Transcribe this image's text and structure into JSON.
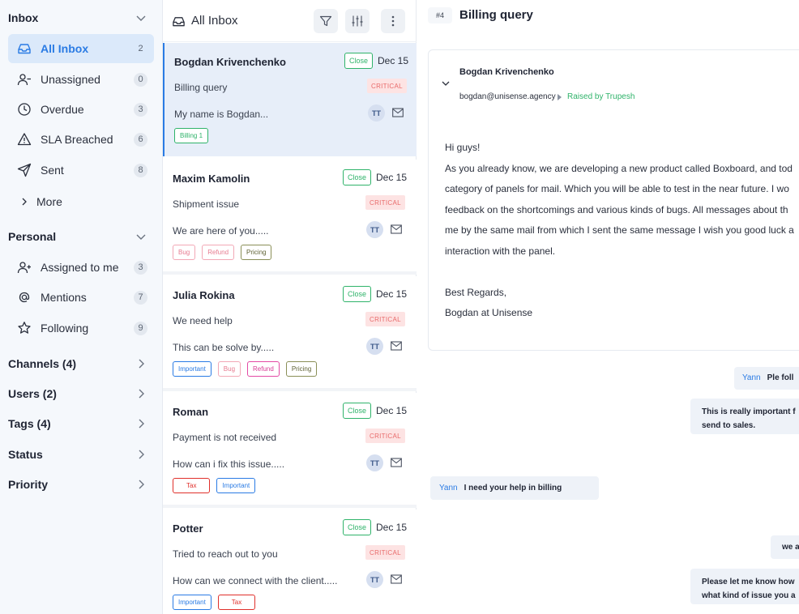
{
  "sidebar": {
    "inbox_section": "Inbox",
    "inbox_items": [
      {
        "label": "All Inbox",
        "count": "2",
        "icon": "inbox-icon",
        "active": true
      },
      {
        "label": "Unassigned",
        "count": "0",
        "icon": "user-minus-icon"
      },
      {
        "label": "Overdue",
        "count": "3",
        "icon": "clock-icon"
      },
      {
        "label": "SLA Breached",
        "count": "6",
        "icon": "warning-icon"
      },
      {
        "label": "Sent",
        "count": "8",
        "icon": "send-icon"
      }
    ],
    "more_label": "More",
    "personal_section": "Personal",
    "personal_items": [
      {
        "label": "Assigned to me",
        "count": "3",
        "icon": "user-plus-icon"
      },
      {
        "label": "Mentions",
        "count": "7",
        "icon": "at-icon"
      },
      {
        "label": "Following",
        "count": "9",
        "icon": "star-icon"
      }
    ],
    "groups": [
      {
        "label": "Channels (4)"
      },
      {
        "label": "Users (2)"
      },
      {
        "label": "Tags (4)"
      },
      {
        "label": "Status"
      },
      {
        "label": "Priority"
      }
    ]
  },
  "list": {
    "title": "All Inbox",
    "tickets": [
      {
        "name": "Bogdan Krivenchenko",
        "status": "Close",
        "date": "Dec 15",
        "subject": "Billing query",
        "priority": "CRITICAL",
        "preview": "My name is Bogdan...",
        "avatar": "TT",
        "tags": [
          {
            "label": "Billing 1",
            "color": "green"
          }
        ]
      },
      {
        "name": "Maxim Kamolin",
        "status": "Close",
        "date": "Dec 15",
        "subject": "Shipment issue",
        "priority": "CRITICAL",
        "preview": "We are here of you.....",
        "avatar": "TT",
        "tags": [
          {
            "label": "Bug",
            "color": "pink"
          },
          {
            "label": "Refund",
            "color": "pink"
          },
          {
            "label": "Pricing",
            "color": "olive"
          }
        ]
      },
      {
        "name": "Julia Rokina",
        "status": "Close",
        "date": "Dec 15",
        "subject": "We need help",
        "priority": "CRITICAL",
        "preview": "This can be solve by.....",
        "avatar": "TT",
        "tags": [
          {
            "label": "Important",
            "color": "blue"
          },
          {
            "label": "Bug",
            "color": "pink"
          },
          {
            "label": "Refund",
            "color": "magenta"
          },
          {
            "label": "Pricing",
            "color": "olive"
          }
        ]
      },
      {
        "name": "Roman",
        "status": "Close",
        "date": "Dec 15",
        "subject": "Payment is not received",
        "priority": "CRITICAL",
        "preview": "How can i fix this issue.....",
        "avatar": "TT",
        "tags": [
          {
            "label": "Tax",
            "color": "red"
          },
          {
            "label": "Important",
            "color": "blue"
          }
        ]
      },
      {
        "name": "Potter",
        "status": "Close",
        "date": "Dec 15",
        "subject": "Tried to reach out to you",
        "priority": "CRITICAL",
        "preview": "How can we connect with the client.....",
        "avatar": "TT",
        "tags": [
          {
            "label": "Important",
            "color": "blue"
          },
          {
            "label": "Tax",
            "color": "red"
          }
        ]
      }
    ]
  },
  "detail": {
    "number": "#4",
    "title": "Billing query",
    "sender": "Bogdan Krivenchenko",
    "email": "bogdan@unisense.agency",
    "raised": "Raised by Trupesh",
    "body": [
      "Hi guys!",
      "As you already know, we are developing a new product called Boxboard, and tod",
      "category of panels for mail. Which you will be able to test in the near future. I wo",
      "feedback on the shortcomings and various kinds of bugs. All messages about th",
      "me by the same mail from which I sent the same message I wish you good luck a",
      "interaction with the panel.",
      "",
      "Best Regards,",
      "Bogdan at Unisense"
    ],
    "chats": [
      {
        "who": "Yann",
        "text": "Ple foll"
      },
      {
        "who": "",
        "text": "This is really important f",
        "text2": "send to sales."
      },
      {
        "who": "Yann",
        "text": "I need your help in billing"
      },
      {
        "who": "",
        "text": "we a"
      },
      {
        "who": "",
        "text": "Please let me know how",
        "text2": "what kind of issue you a"
      }
    ]
  },
  "colors": {
    "accent": "#2a7be4",
    "close_green": "#2fb36a",
    "critical_bg": "#fde3e3",
    "critical_text": "#e86a6a"
  }
}
